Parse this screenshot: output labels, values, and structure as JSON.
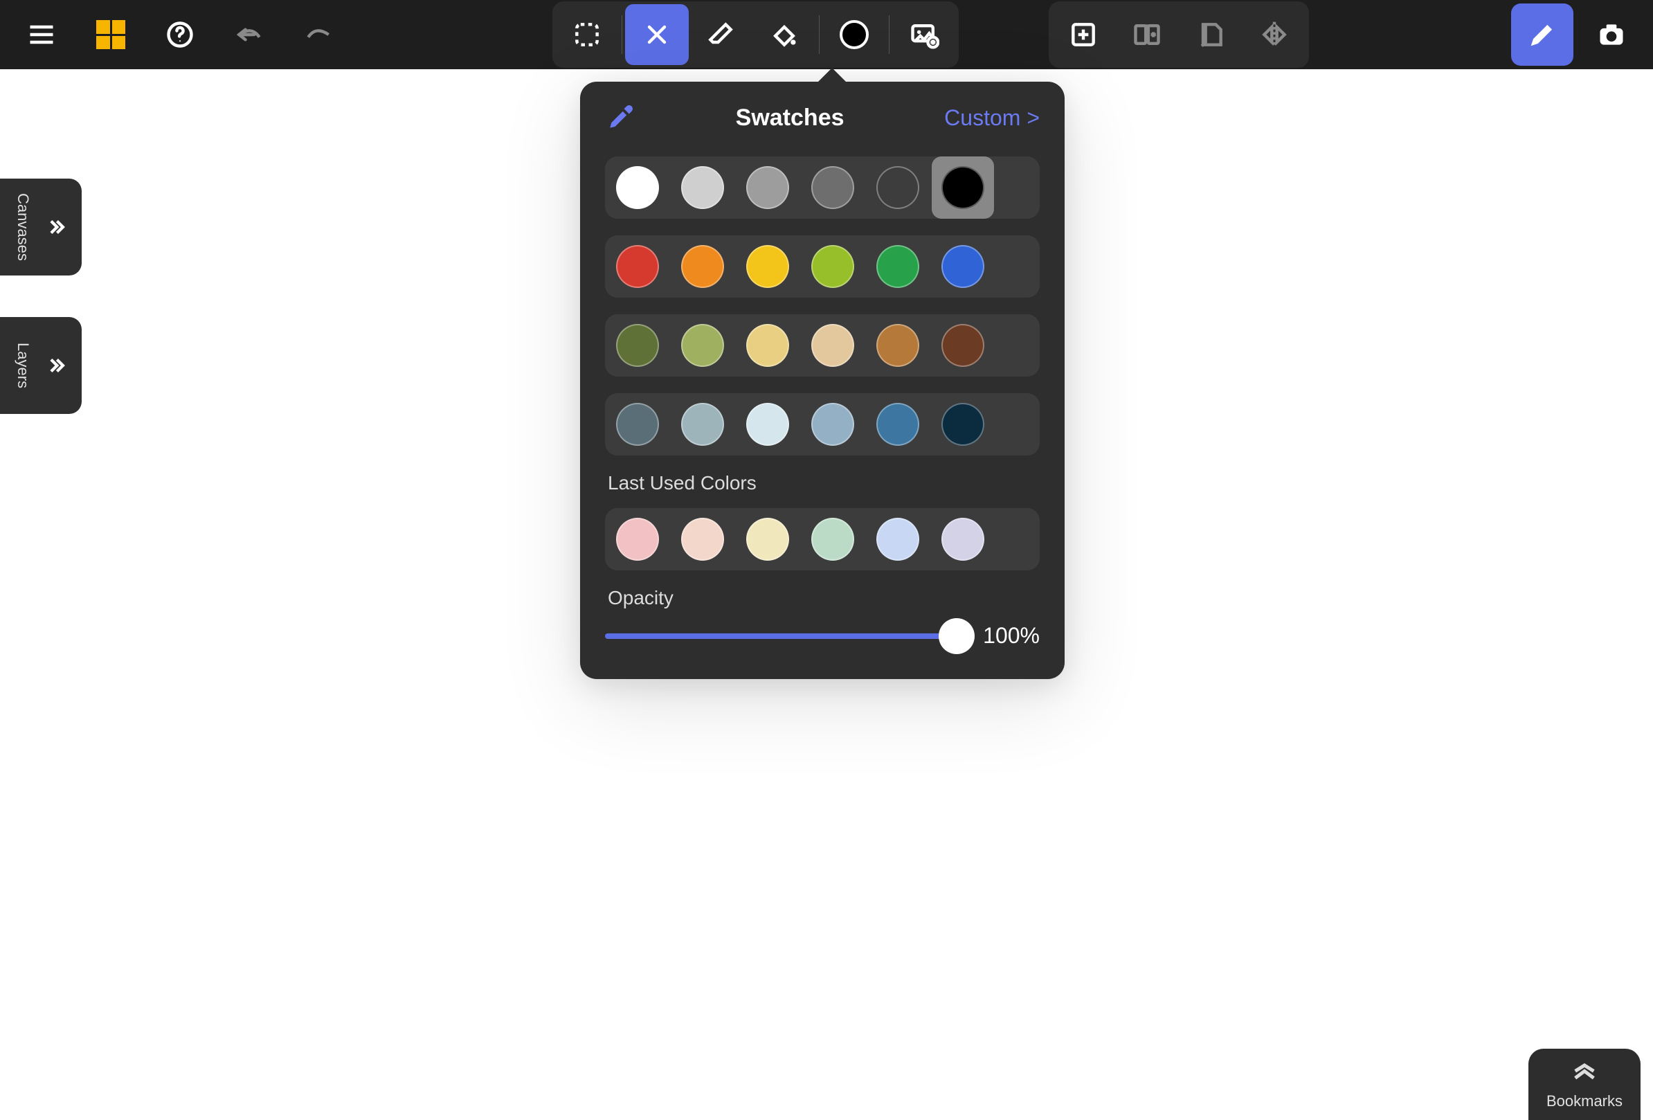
{
  "toolbar": {
    "menu": "menu",
    "dashboard": "dashboard",
    "help": "help",
    "undo": "undo",
    "redo": "redo",
    "select": "select",
    "draw": "draw",
    "erase": "erase",
    "fill": "fill",
    "color": "#000000",
    "insert_image": "insert-image",
    "add_canvas": "add-canvas",
    "split": "split",
    "page": "page",
    "mirror": "mirror",
    "pen": "pen",
    "camera": "camera"
  },
  "side": {
    "canvases": "Canvases",
    "layers": "Layers"
  },
  "pop": {
    "title": "Swatches",
    "custom": "Custom >",
    "last_used": "Last Used Colors",
    "opacity_label": "Opacity",
    "opacity_value": "100%",
    "rows": [
      [
        "#ffffff",
        "#cfcfcf",
        "#9d9d9d",
        "#6e6e6e",
        "#3d3d3d",
        "#000000"
      ],
      [
        "#d63a2f",
        "#ef8a1e",
        "#f3c41a",
        "#97bf2a",
        "#27a24a",
        "#2f63d6"
      ],
      [
        "#5f7136",
        "#9fb060",
        "#e9cf82",
        "#e3c89e",
        "#b57a3a",
        "#6b3b23"
      ],
      [
        "#5a6e77",
        "#9db4bb",
        "#d5e7ed",
        "#94b0c4",
        "#3d76a0",
        "#0b2c3f"
      ]
    ],
    "last_used_row": [
      "#f2c1c3",
      "#f3d7cb",
      "#f1e7bd",
      "#bcdbc7",
      "#c7d7f4",
      "#d3d2e7"
    ],
    "selected_row": 0,
    "selected_col": 5
  },
  "bookmarks": {
    "label": "Bookmarks"
  }
}
